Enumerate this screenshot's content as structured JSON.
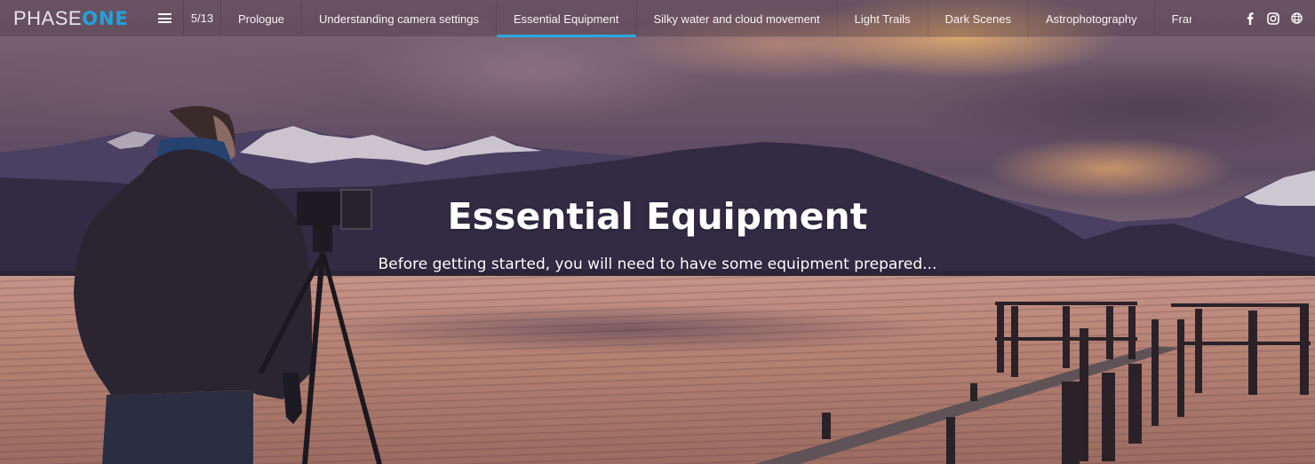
{
  "brand": {
    "logo_light": "PHASE",
    "logo_bold": "ONE",
    "accent_color": "#1fa3de"
  },
  "nav": {
    "menu_icon": "hamburger-menu-icon",
    "counter": "5/13",
    "tabs": [
      {
        "label": "Prologue",
        "active": false
      },
      {
        "label": "Understanding camera settings",
        "active": false
      },
      {
        "label": "Essential Equipment",
        "active": true
      },
      {
        "label": "Silky water and cloud movement",
        "active": false
      },
      {
        "label": "Light Trails",
        "active": false
      },
      {
        "label": "Dark Scenes",
        "active": false
      },
      {
        "label": "Astrophotography",
        "active": false
      },
      {
        "label": "Frame Av",
        "active": false
      }
    ],
    "social": [
      {
        "icon": "facebook-icon"
      },
      {
        "icon": "instagram-icon"
      },
      {
        "icon": "globe-icon"
      }
    ]
  },
  "hero": {
    "title": "Essential Equipment",
    "subtitle": "Before getting started, you will need to have some equipment prepared...",
    "image_description": "Photographer with camera on tripod at lakeside at dusk, snowy mountains and wooden jetty"
  }
}
